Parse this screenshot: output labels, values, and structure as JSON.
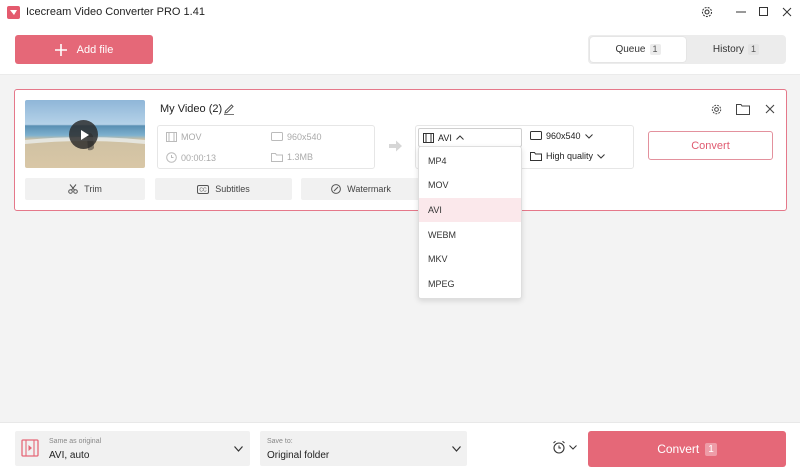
{
  "app": {
    "title": "Icecream Video Converter PRO 1.41"
  },
  "header": {
    "add_file_label": "Add file",
    "tabs": [
      {
        "label": "Queue",
        "count": "1",
        "active": true
      },
      {
        "label": "History",
        "count": "1",
        "active": false
      }
    ]
  },
  "file": {
    "name": "My Video (2)",
    "source": {
      "format": "MOV",
      "resolution": "960x540",
      "duration": "00:00:13",
      "size": "1.3MB"
    },
    "output": {
      "format": "AVI",
      "resolution": "960x540",
      "quality": "High quality"
    },
    "convert_label": "Convert",
    "tools": [
      "Trim",
      "Subtitles",
      "Watermark"
    ]
  },
  "format_dropdown": {
    "options": [
      "MP4",
      "MOV",
      "AVI",
      "WEBM",
      "MKV",
      "MPEG"
    ],
    "selected": "AVI"
  },
  "bottom": {
    "preset_label": "Same as original",
    "preset_value": "AVI, auto",
    "save_label": "Save to:",
    "save_value": "Original folder",
    "convert_label": "Convert",
    "convert_count": "1"
  },
  "colors": {
    "accent": "#e56878",
    "selected_bg": "#fbe8eb"
  },
  "icons": [
    "app-logo-icon",
    "gear-icon",
    "minimize-icon",
    "maximize-icon",
    "close-icon",
    "plus-icon",
    "play-icon",
    "pencil-icon",
    "film-icon",
    "monitor-icon",
    "clock-icon",
    "folder-icon",
    "arrow-right-icon",
    "chevron-up-icon",
    "chevron-down-icon",
    "scissors-icon",
    "subtitles-icon",
    "watermark-icon",
    "alarm-icon"
  ]
}
